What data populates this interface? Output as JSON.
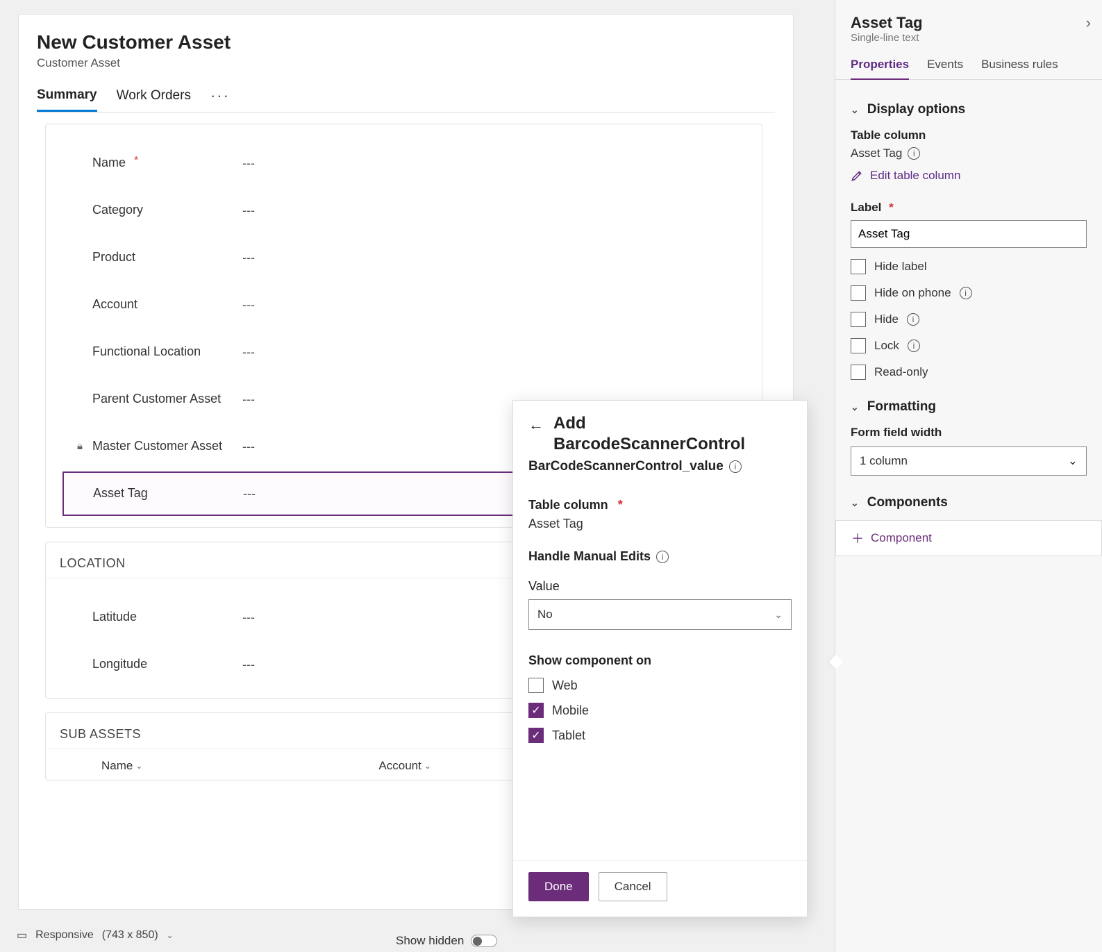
{
  "page": {
    "title": "New Customer Asset",
    "subtitle": "Customer Asset",
    "tabs": [
      "Summary",
      "Work Orders"
    ],
    "active_tab": 0,
    "more_label": "···"
  },
  "summary_fields": [
    {
      "label": "Name",
      "value": "---",
      "required": true,
      "locked": false
    },
    {
      "label": "Category",
      "value": "---",
      "required": false,
      "locked": false
    },
    {
      "label": "Product",
      "value": "---",
      "required": false,
      "locked": false
    },
    {
      "label": "Account",
      "value": "---",
      "required": false,
      "locked": false
    },
    {
      "label": "Functional Location",
      "value": "---",
      "required": false,
      "locked": false
    },
    {
      "label": "Parent Customer Asset",
      "value": "---",
      "required": false,
      "locked": false
    },
    {
      "label": "Master Customer Asset",
      "value": "---",
      "required": false,
      "locked": true
    },
    {
      "label": "Asset Tag",
      "value": "---",
      "required": false,
      "locked": false,
      "selected": true
    }
  ],
  "sections": {
    "location": {
      "title": "LOCATION",
      "fields": [
        {
          "label": "Latitude",
          "value": "---"
        },
        {
          "label": "Longitude",
          "value": "---"
        }
      ]
    },
    "sub_assets": {
      "title": "SUB ASSETS",
      "columns": [
        "Name",
        "Account"
      ]
    }
  },
  "footer": {
    "mode": "Responsive",
    "dimensions": "(743 x 850)",
    "show_hidden_label": "Show hidden",
    "show_hidden_on": false
  },
  "flyout": {
    "title_line1": "Add",
    "title_line2": "BarcodeScannerControl",
    "subtitle": "BarCodeScannerControl_value",
    "table_column_label": "Table column",
    "table_column_value": "Asset Tag",
    "manual_edits_label": "Handle Manual Edits",
    "value_label": "Value",
    "value_selected": "No",
    "show_on_label": "Show component on",
    "show_on": {
      "web": false,
      "mobile": true,
      "tablet": true
    },
    "show_on_labels": {
      "web": "Web",
      "mobile": "Mobile",
      "tablet": "Tablet"
    },
    "done": "Done",
    "cancel": "Cancel"
  },
  "right_panel": {
    "title": "Asset Tag",
    "subtitle": "Single-line text",
    "tabs": [
      "Properties",
      "Events",
      "Business rules"
    ],
    "active_tab": 0,
    "display_options": {
      "title": "Display options",
      "table_column_label": "Table column",
      "table_column_value": "Asset Tag",
      "edit_link": "Edit table column",
      "label_label": "Label",
      "label_value": "Asset Tag",
      "checkboxes": [
        {
          "label": "Hide label",
          "info": false
        },
        {
          "label": "Hide on phone",
          "info": true
        },
        {
          "label": "Hide",
          "info": true
        },
        {
          "label": "Lock",
          "info": true
        },
        {
          "label": "Read-only",
          "info": false
        }
      ]
    },
    "formatting": {
      "title": "Formatting",
      "width_label": "Form field width",
      "width_value": "1 column"
    },
    "components": {
      "title": "Components",
      "add_label": "Component"
    }
  }
}
